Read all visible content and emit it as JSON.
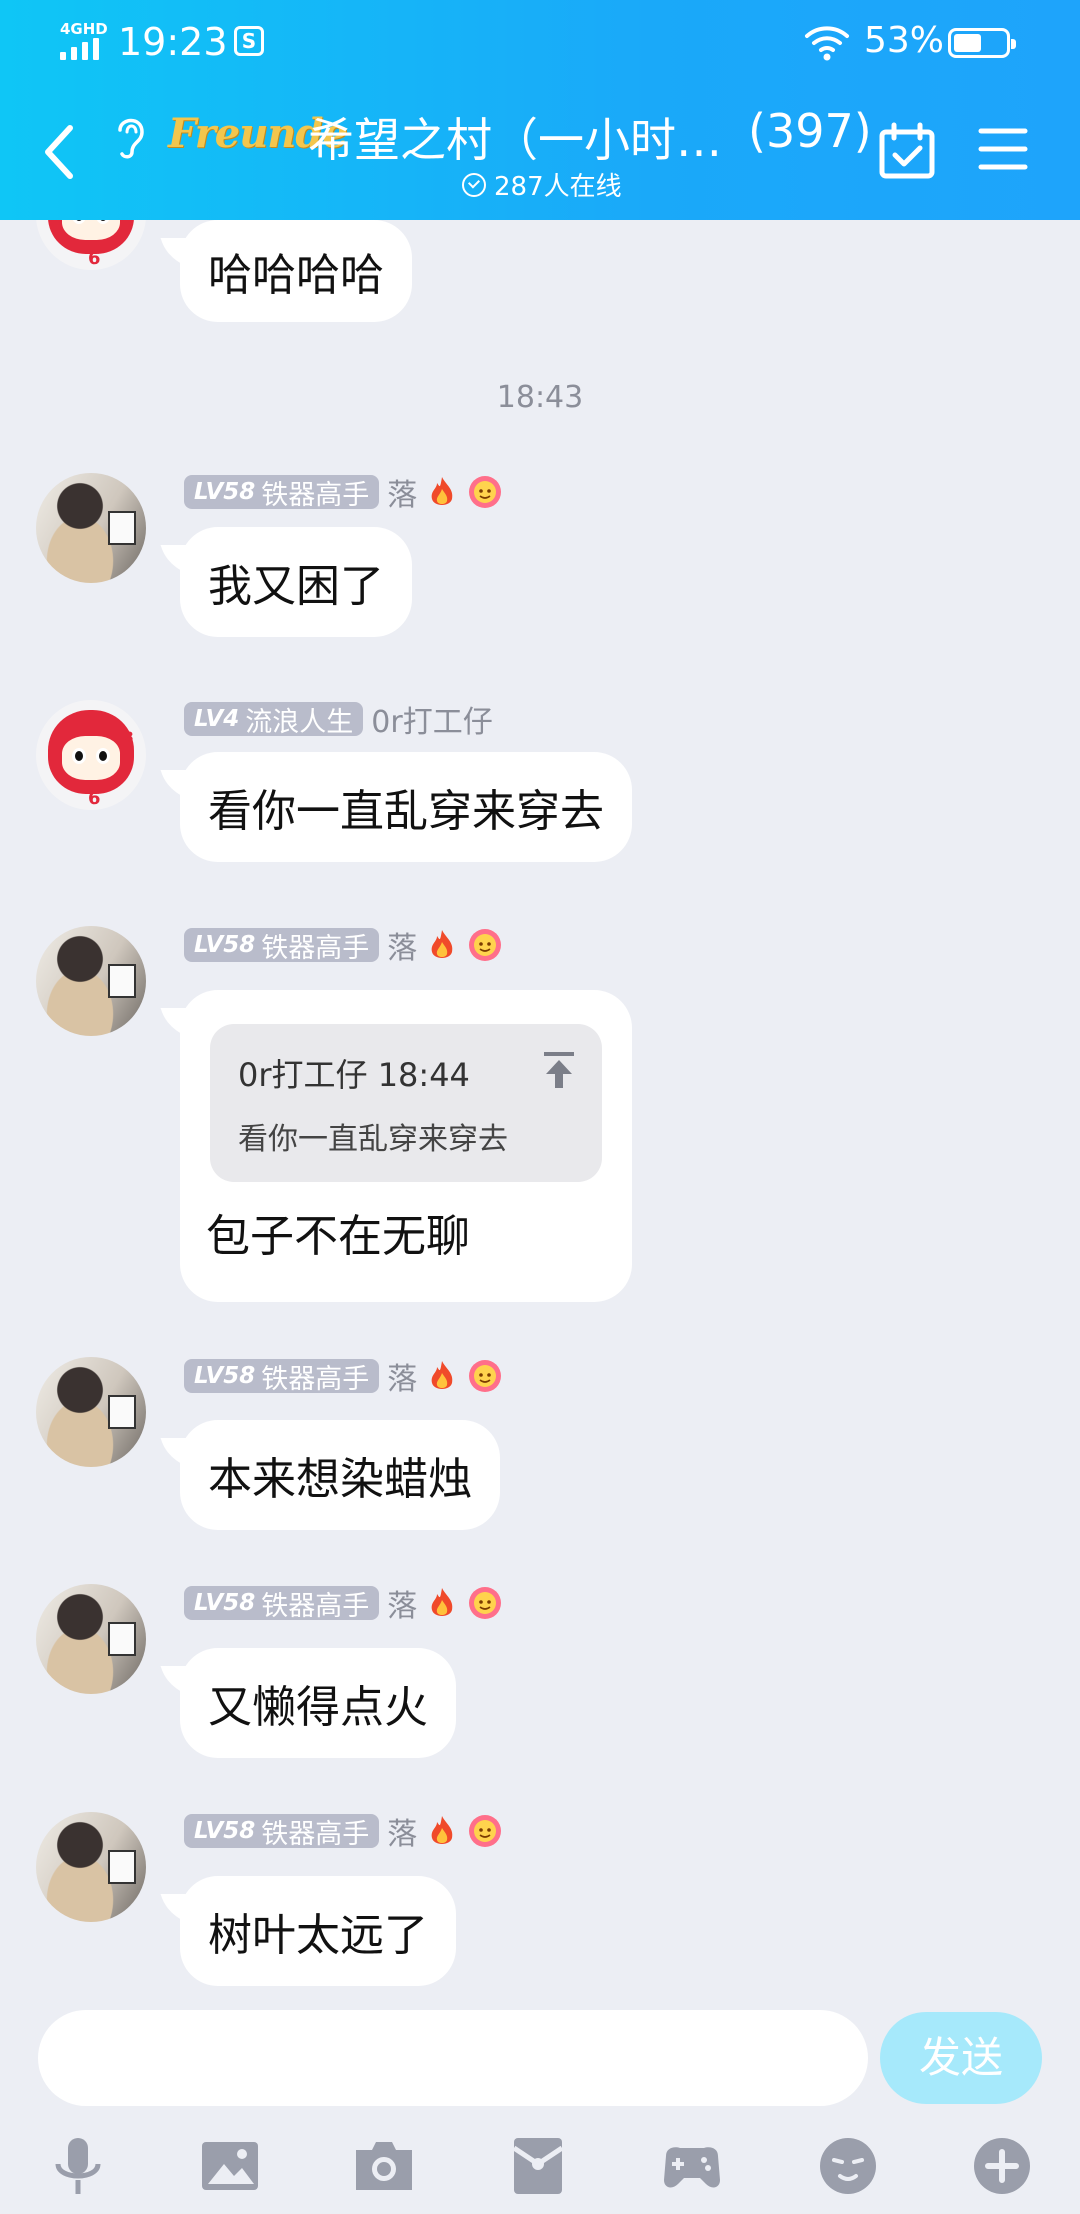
{
  "status_bar": {
    "network": "4GHD",
    "time": "19:23",
    "notify_icon": "S",
    "battery_pct": "53%",
    "battery_level": 0.53
  },
  "header": {
    "logo_text": "Freunde",
    "title": "希望之村（一小时…",
    "member_count": "(397)",
    "online": "287人在线"
  },
  "chat": {
    "top_partial": {
      "text": "哈哈哈哈"
    },
    "timestamp": "18:43",
    "messages": [
      {
        "level": "LV58",
        "title": "铁器高手",
        "name": "落",
        "text": "我又困了"
      },
      {
        "level": "LV4",
        "title": "流浪人生",
        "name": "0r打工仔",
        "text": "看你一直乱穿来穿去"
      },
      {
        "level": "LV58",
        "title": "铁器高手",
        "name": "落",
        "quote": {
          "author_time": "0r打工仔 18:44",
          "text": "看你一直乱穿来穿去"
        },
        "text": "包子不在无聊"
      },
      {
        "level": "LV58",
        "title": "铁器高手",
        "name": "落",
        "text": "本来想染蜡烛"
      },
      {
        "level": "LV58",
        "title": "铁器高手",
        "name": "落",
        "text": "又懒得点火"
      },
      {
        "level": "LV58",
        "title": "铁器高手",
        "name": "落",
        "text": "树叶太远了"
      }
    ]
  },
  "input": {
    "placeholder": "",
    "send_label": "发送"
  },
  "toolbar": [
    "microphone-icon",
    "image-icon",
    "camera-icon",
    "red-packet-icon",
    "game-icon",
    "emoji-icon",
    "plus-icon"
  ],
  "colors": {
    "header_start": "#0fc6f6",
    "header_end": "#1ea4fb",
    "background": "#eceef4",
    "send_disabled": "#a6e9fb",
    "level_badge": "#b9bccb"
  }
}
